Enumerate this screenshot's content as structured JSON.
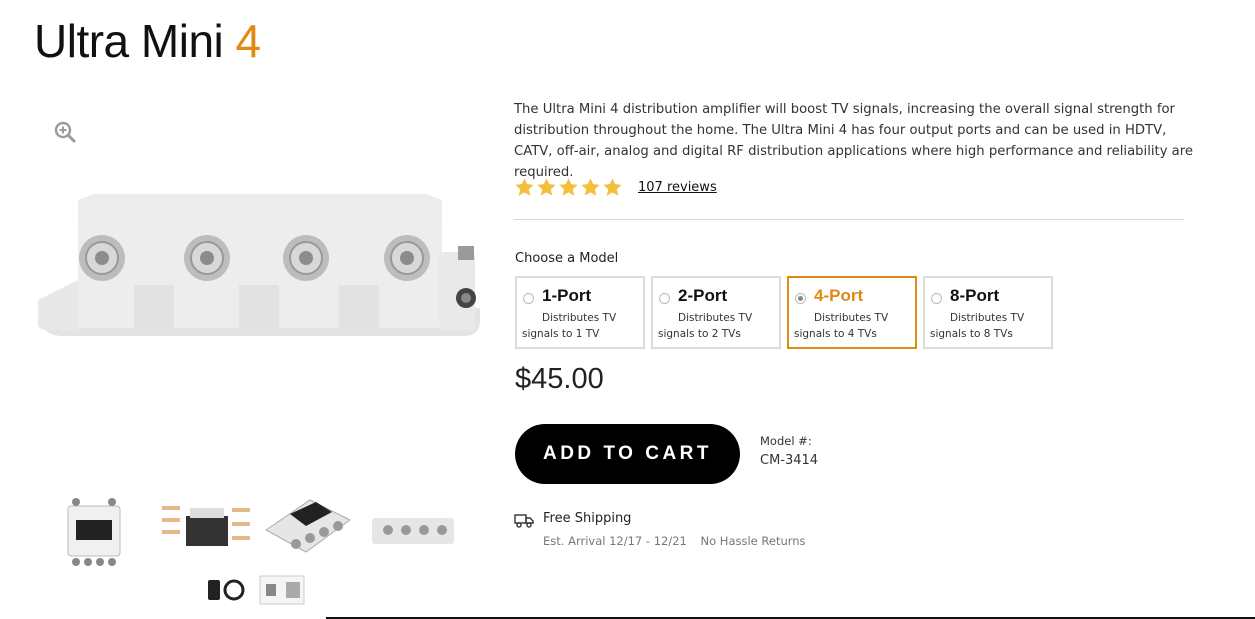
{
  "product": {
    "title_main": "Ultra Mini ",
    "title_accent": "4",
    "description": "The Ultra Mini 4 distribution amplifier will boost TV signals, increasing the overall signal strength for distribution throughout the home. The Ultra Mini 4 has four output ports and can be used in HDTV, CATV, off-air, analog and digital RF distribution applications where high performance and reliability are required.",
    "rating": 5,
    "reviews_label": "107 reviews",
    "price": "$45.00"
  },
  "models": {
    "label": "Choose a Model",
    "options": [
      {
        "name": "1-Port",
        "desc": "Distributes TV signals to 1 TV",
        "selected": false
      },
      {
        "name": "2-Port",
        "desc": "Distributes TV signals to 2 TVs",
        "selected": false
      },
      {
        "name": "4-Port",
        "desc": "Distributes TV signals to 4 TVs",
        "selected": true
      },
      {
        "name": "8-Port",
        "desc": "Distributes TV signals to 8 TVs",
        "selected": false
      }
    ]
  },
  "cart": {
    "label": "ADD TO CART"
  },
  "model_number": {
    "label": "Model #:",
    "value": "CM-3414"
  },
  "shipping": {
    "label": "Free Shipping",
    "arrival": "Est. Arrival 12/17 - 12/21",
    "returns": "No Hassle Returns"
  },
  "colors": {
    "accent": "#e08a14",
    "star": "#f5be3c",
    "button": "#000000"
  },
  "icons": {
    "zoom": "zoom-in-icon",
    "star": "star-icon",
    "truck": "truck-icon"
  }
}
